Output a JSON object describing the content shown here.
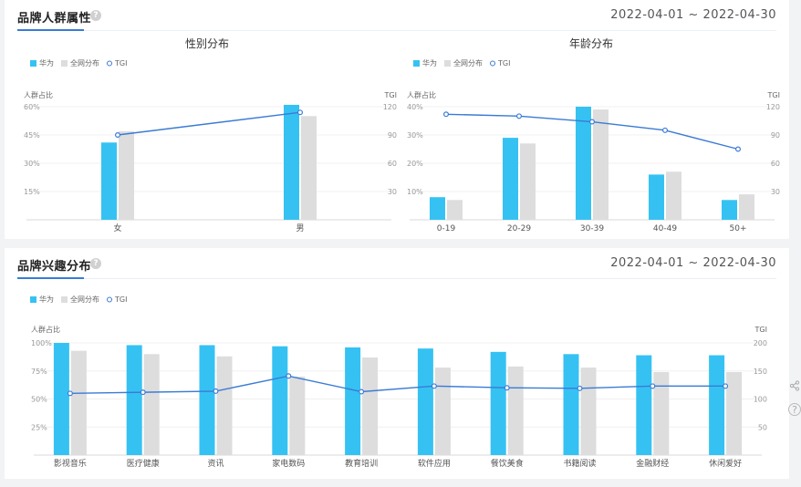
{
  "cards": [
    {
      "title": "品牌人群属性",
      "help_icon": "?",
      "date_range": "2022-04-01 ~ 2022-04-30",
      "charts": [
        {
          "id": "gender",
          "title": "性别分布",
          "legend": [
            "华为",
            "全网分布",
            "TGI"
          ],
          "ylabel_left": "人群占比",
          "ylabel_right": "TGI",
          "left_ticks": [
            "60%",
            "45%",
            "30%",
            "15%"
          ],
          "right_ticks": [
            "120",
            "90",
            "60",
            "30"
          ]
        },
        {
          "id": "age",
          "title": "年龄分布",
          "legend": [
            "华为",
            "全网分布",
            "TGI"
          ],
          "ylabel_left": "人群占比",
          "ylabel_right": "TGI",
          "left_ticks": [
            "40%",
            "30%",
            "20%",
            "10%"
          ],
          "right_ticks": [
            "120",
            "90",
            "60",
            "30"
          ]
        }
      ]
    },
    {
      "title": "品牌兴趣分布",
      "help_icon": "?",
      "date_range": "2022-04-01 ~ 2022-04-30",
      "charts": [
        {
          "id": "interest",
          "title": "",
          "legend": [
            "华为",
            "全网分布",
            "TGI"
          ],
          "ylabel_left": "人群占比",
          "ylabel_right": "TGI",
          "left_ticks": [
            "100%",
            "75%",
            "50%",
            "25%"
          ],
          "right_ticks": [
            "200",
            "150",
            "100",
            "50"
          ]
        }
      ]
    }
  ],
  "colors": {
    "brand": "#35c2f3",
    "market": "#dddddd",
    "tgi": "#3a7bd5",
    "accent": "#3a7bd5"
  },
  "side_icons": [
    "share-icon",
    "help-icon"
  ],
  "chart_data": [
    {
      "type": "bar",
      "title": "性别分布",
      "categories": [
        "女",
        "男"
      ],
      "series": [
        {
          "name": "华为",
          "values": [
            41,
            61
          ]
        },
        {
          "name": "全网分布",
          "values": [
            47,
            55
          ]
        },
        {
          "name": "TGI",
          "type": "line",
          "axis": "right",
          "values": [
            90,
            114
          ]
        }
      ],
      "ylabel": "人群占比",
      "ylabel_right": "TGI",
      "ylim": [
        0,
        60
      ],
      "ylim_right": [
        0,
        120
      ],
      "legend": "top-left",
      "grid": true
    },
    {
      "type": "bar",
      "title": "年龄分布",
      "categories": [
        "0-19",
        "20-29",
        "30-39",
        "40-49",
        "50+"
      ],
      "series": [
        {
          "name": "华为",
          "values": [
            8,
            29,
            40,
            16,
            7
          ]
        },
        {
          "name": "全网分布",
          "values": [
            7,
            27,
            39,
            17,
            9
          ]
        },
        {
          "name": "TGI",
          "type": "line",
          "axis": "right",
          "values": [
            112,
            110,
            104,
            95,
            75
          ]
        }
      ],
      "ylabel": "人群占比",
      "ylabel_right": "TGI",
      "ylim": [
        0,
        40
      ],
      "ylim_right": [
        0,
        120
      ],
      "legend": "top-left",
      "grid": true
    },
    {
      "type": "bar",
      "title": "",
      "categories": [
        "影视音乐",
        "医疗健康",
        "资讯",
        "家电数码",
        "教育培训",
        "软件应用",
        "餐饮美食",
        "书籍阅读",
        "金融财经",
        "休闲爱好"
      ],
      "series": [
        {
          "name": "华为",
          "values": [
            100,
            98,
            98,
            97,
            96,
            95,
            92,
            90,
            89,
            89
          ]
        },
        {
          "name": "全网分布",
          "values": [
            93,
            90,
            88,
            70,
            87,
            78,
            79,
            78,
            74,
            74
          ]
        },
        {
          "name": "TGI",
          "type": "line",
          "axis": "right",
          "values": [
            110,
            112,
            114,
            141,
            113,
            123,
            120,
            119,
            123,
            123
          ]
        }
      ],
      "ylabel": "人群占比",
      "ylabel_right": "TGI",
      "ylim": [
        0,
        100
      ],
      "ylim_right": [
        0,
        200
      ],
      "legend": "top-left",
      "grid": true
    }
  ]
}
